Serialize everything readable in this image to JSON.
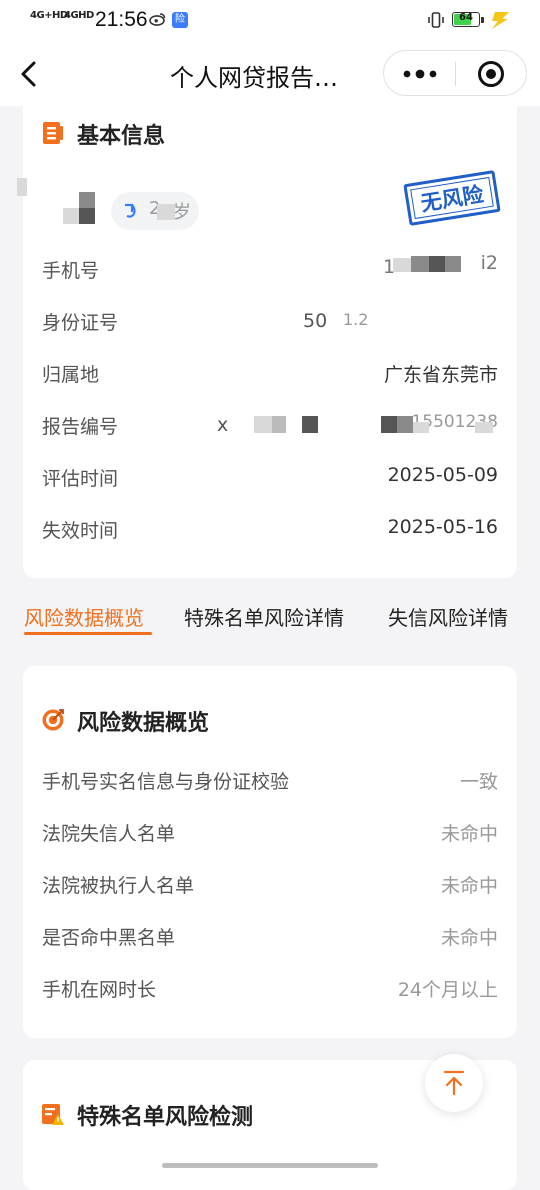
{
  "status_bar": {
    "network_1": "4G+HD",
    "network_2": "4GHD",
    "time": "21:56",
    "app_badge": "险",
    "battery": "64"
  },
  "nav": {
    "title": "个人网贷报告…"
  },
  "basic_info": {
    "title": "基本信息",
    "age_suffix": "岁",
    "age_visible": "2",
    "stamp": "无风险",
    "rows": [
      {
        "label": "手机号",
        "value": ""
      },
      {
        "label": "身份证号",
        "value": ""
      },
      {
        "label": "归属地",
        "value": "广东省东莞市"
      },
      {
        "label": "报告编号",
        "value": ""
      },
      {
        "label": "评估时间",
        "value": "2025-05-09"
      },
      {
        "label": "失效时间",
        "value": "2025-05-16"
      }
    ],
    "partial": {
      "phone_tail": "i2",
      "phone_head": "1",
      "id_head": "50",
      "id_mid": "1.2",
      "report_head": "x",
      "report_tail": "15501238"
    }
  },
  "tabs": [
    {
      "label": "风险数据概览",
      "active": true
    },
    {
      "label": "特殊名单风险详情",
      "active": false
    },
    {
      "label": "失信风险详情",
      "active": false
    }
  ],
  "overview": {
    "title": "风险数据概览",
    "rows": [
      {
        "label": "手机号实名信息与身份证校验",
        "value": "一致"
      },
      {
        "label": "法院失信人名单",
        "value": "未命中"
      },
      {
        "label": "法院被执行人名单",
        "value": "未命中"
      },
      {
        "label": "是否命中黑名单",
        "value": "未命中"
      },
      {
        "label": "手机在网时长",
        "value": "24个月以上"
      }
    ]
  },
  "special_list": {
    "title": "特殊名单风险检测"
  },
  "colors": {
    "accent": "#f0701d",
    "stamp_blue": "#1f5fc7",
    "background": "#f4f4f6"
  },
  "icons": {
    "back": "chevron-left-icon",
    "more": "more-dots-icon",
    "close": "target-close-icon",
    "basic_info": "document-list-icon",
    "overview": "target-icon",
    "special_list": "warning-list-icon",
    "scroll_top": "arrow-up-icon"
  }
}
